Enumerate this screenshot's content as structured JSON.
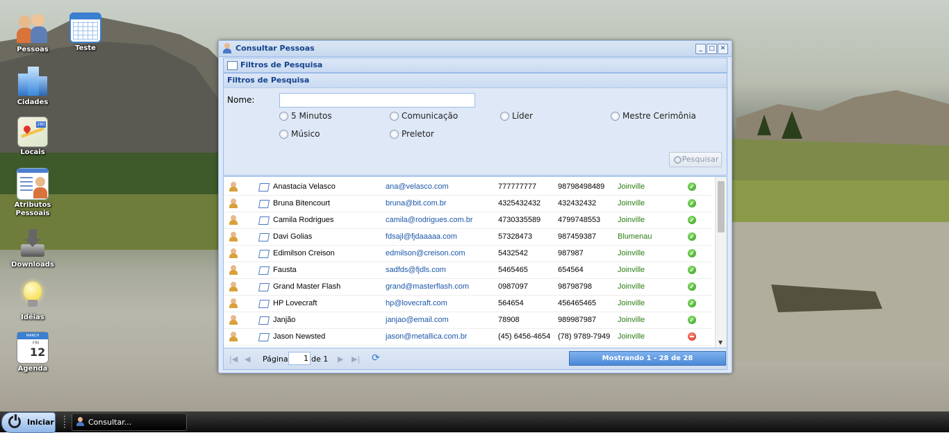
{
  "desktop": {
    "icons": [
      {
        "label": "Pessoas",
        "icon": "people-icon"
      },
      {
        "label": "Teste",
        "icon": "calendar-grid-icon"
      },
      {
        "label": "Cidades",
        "icon": "buildings-icon"
      },
      {
        "label": "Locais",
        "icon": "map-icon"
      },
      {
        "label": "Atributos Pessoais",
        "icon": "person-card-icon"
      },
      {
        "label": "Downloads",
        "icon": "download-icon"
      },
      {
        "label": "Idéias",
        "icon": "lightbulb-icon"
      },
      {
        "label": "Agenda",
        "icon": "agenda-calendar-icon",
        "month": "MARCH",
        "day": "12",
        "weekday": "FRI"
      }
    ]
  },
  "window": {
    "title": "Consultar Pessoas",
    "panel_title": "Filtros de Pesquisa",
    "fieldset_title": "Filtros de Pesquisa",
    "nome_label": "Nome:",
    "nome_value": "",
    "options": [
      "5 Minutos",
      "Comunicação",
      "Líder",
      "Mestre Cerimônia",
      "Músico",
      "Preletor"
    ],
    "search_button": "Pesquisar",
    "rows": [
      {
        "name": "Anastacia Velasco",
        "email": "ana@velasco.com",
        "phone1": "777777777",
        "phone2": "98798498489",
        "city": "Joinville",
        "active": true
      },
      {
        "name": "Bruna Bitencourt",
        "email": "bruna@bit.com.br",
        "phone1": "4325432432",
        "phone2": "432432432",
        "city": "Joinville",
        "active": true
      },
      {
        "name": "Camila Rodrigues",
        "email": "camila@rodrigues.com.br",
        "phone1": "4730335589",
        "phone2": "4799748553",
        "city": "Joinville",
        "active": true
      },
      {
        "name": "Davi Golias",
        "email": "fdsajl@fjdaaaaa.com",
        "phone1": "57328473",
        "phone2": "987459387",
        "city": "Blumenau",
        "active": true
      },
      {
        "name": "Edimilson Creison",
        "email": "edmilson@creison.com",
        "phone1": "5432542",
        "phone2": "987987",
        "city": "Joinville",
        "active": true
      },
      {
        "name": "Fausta",
        "email": "sadfds@fjdls.com",
        "phone1": "5465465",
        "phone2": "654564",
        "city": "Joinville",
        "active": true
      },
      {
        "name": "Grand Master Flash",
        "email": "grand@masterflash.com",
        "phone1": "0987097",
        "phone2": "98798798",
        "city": "Joinville",
        "active": true
      },
      {
        "name": "HP Lovecraft",
        "email": "hp@lovecraft.com",
        "phone1": "564654",
        "phone2": "456465465",
        "city": "Joinville",
        "active": true
      },
      {
        "name": "Janjão",
        "email": "janjao@email.com",
        "phone1": "78908",
        "phone2": "989987987",
        "city": "Joinville",
        "active": true
      },
      {
        "name": "Jason Newsted",
        "email": "jason@metallica.com.br",
        "phone1": "(45) 6456-4654",
        "phone2": "(78) 9789-7949",
        "city": "Joinville",
        "active": false
      }
    ],
    "pager": {
      "page_label": "Página",
      "page_value": "1",
      "of_label": "de 1",
      "status": "Mostrando 1 - 28 de 28"
    }
  },
  "taskbar": {
    "start_label": "Iniciar",
    "task_label": "Consultar..."
  },
  "colors": {
    "window_bg": "#dfe8f6",
    "header_text": "#15428b",
    "link": "#1a56a8",
    "city": "#2a7d10",
    "status_bar": "#4c89d9"
  }
}
